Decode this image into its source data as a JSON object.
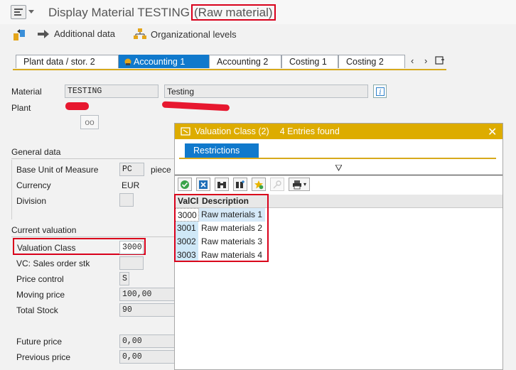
{
  "window": {
    "title": "Display Material TESTING",
    "title_highlight": "(Raw material)"
  },
  "toolbar": {
    "additional_data": "Additional data",
    "org_levels": "Organizational levels"
  },
  "tabs": [
    {
      "label": "Plant data / stor. 2"
    },
    {
      "label": "Accounting 1"
    },
    {
      "label": "Accounting 2"
    },
    {
      "label": "Costing 1"
    },
    {
      "label": "Costing 2"
    }
  ],
  "header": {
    "material_label": "Material",
    "material_value": "TESTING",
    "material_desc": "Testing",
    "plant_label": "Plant"
  },
  "general": {
    "title": "General data",
    "base_uom_label": "Base Unit of Measure",
    "base_uom_value": "PC",
    "base_uom_text": "piece",
    "currency_label": "Currency",
    "currency_value": "EUR",
    "division_label": "Division"
  },
  "valuation": {
    "title": "Current valuation",
    "valclass_label": "Valuation Class",
    "valclass_value": "3000",
    "vc_sales_label": "VC: Sales order stk",
    "price_control_label": "Price control",
    "price_control_value": "S",
    "moving_price_label": "Moving price",
    "moving_price_value": "100,00",
    "total_stock_label": "Total Stock",
    "total_stock_value": "90",
    "future_price_label": "Future price",
    "future_price_value": "0,00",
    "previous_price_label": "Previous price",
    "previous_price_value": "0,00"
  },
  "popup": {
    "title": "Valuation Class (2)",
    "entries": "4 Entries found",
    "restrictions_tab": "Restrictions",
    "col_key": "ValCl",
    "col_desc": "Description",
    "rows": [
      {
        "key": "3000",
        "desc": "Raw materials 1"
      },
      {
        "key": "3001",
        "desc": "Raw materials 2"
      },
      {
        "key": "3002",
        "desc": "Raw materials 3"
      },
      {
        "key": "3003",
        "desc": "Raw materials 4"
      }
    ]
  },
  "colors": {
    "highlight_red": "#d9001b",
    "popup_header": "#ddac00",
    "tab_active": "#1079cc"
  }
}
